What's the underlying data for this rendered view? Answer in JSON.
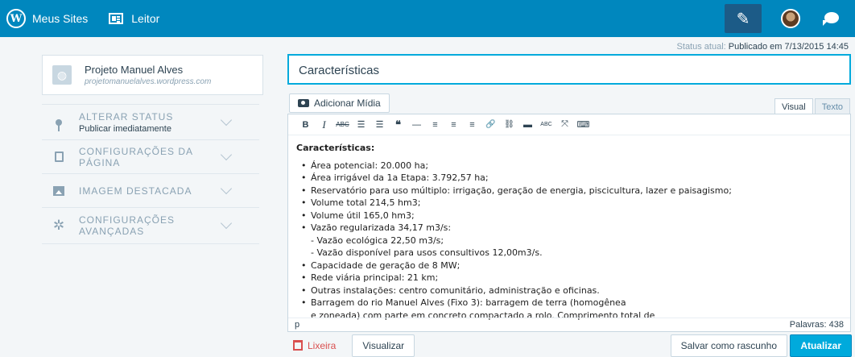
{
  "topbar": {
    "my_sites": "Meus Sites",
    "reader": "Leitor",
    "icons": [
      "wordpress-logo-icon",
      "reader-icon",
      "write-post-icon",
      "avatar",
      "notifications-icon"
    ]
  },
  "status": {
    "prefix": "Status atual:",
    "value": "Publicado em 7/13/2015 14:45"
  },
  "site": {
    "name": "Projeto Manuel Alves",
    "url": "projetomanuelalves.wordpress.com"
  },
  "sidebar": {
    "sections": [
      {
        "label": "ALTERAR STATUS",
        "sub": "Publicar imediatamente",
        "icon": "pin-icon"
      },
      {
        "label": "CONFIGURAÇÕES DA PÁGINA",
        "icon": "document-icon"
      },
      {
        "label": "IMAGEM DESTACADA",
        "icon": "image-icon"
      },
      {
        "label": "CONFIGURAÇÕES AVANÇADAS",
        "icon": "gear-icon"
      }
    ]
  },
  "editor": {
    "title": "Características",
    "add_media": "Adicionar Mídia",
    "tab_visual": "Visual",
    "tab_text": "Texto",
    "toolbar": [
      "B",
      "I",
      "ABC",
      "☰",
      "☰",
      "❝",
      "—",
      "≡",
      "≡",
      "≡",
      "🔗",
      "⛓",
      "▬",
      "ABC",
      "⤧",
      "⌨"
    ],
    "heading": "Características:",
    "items": [
      {
        "t": "Área potencial: 20.000 ha;",
        "b": true
      },
      {
        "t": "Área irrigável da 1a Etapa: 3.792,57 ha;",
        "b": true
      },
      {
        "t": "Reservatório para uso múltiplo: irrigação, geração de energia, piscicultura, lazer e paisagismo;",
        "b": true
      },
      {
        "t": "Volume total 214,5 hm3;",
        "b": true
      },
      {
        "t": "Volume útil 165,0 hm3;",
        "b": true
      },
      {
        "t": "Vazão regularizada 34,17 m3/s:",
        "b": true
      },
      {
        "t": "- Vazão ecológica 22,50 m3/s;",
        "b": false
      },
      {
        "t": "- Vazão disponível para usos consultivos 12,00m3/s.",
        "b": false
      },
      {
        "t": "Capacidade de geração de 8 MW;",
        "b": true
      },
      {
        "t": "Rede viária principal: 21 km;",
        "b": true
      },
      {
        "t": "Outras instalações: centro comunitário, administração e oficinas.",
        "b": true
      },
      {
        "t": "Barragem do rio Manuel Alves (Fixo 3): barragem de terra (homogênea",
        "b": true
      },
      {
        "t": "e zoneada) com parte em concreto compactado a rolo. Comprimento total de",
        "b": false
      }
    ],
    "path": "p",
    "word_count": "Palavras: 438"
  },
  "actions": {
    "trash": "Lixeira",
    "preview": "Visualizar",
    "save_draft": "Salvar como rascunho",
    "update": "Atualizar"
  }
}
